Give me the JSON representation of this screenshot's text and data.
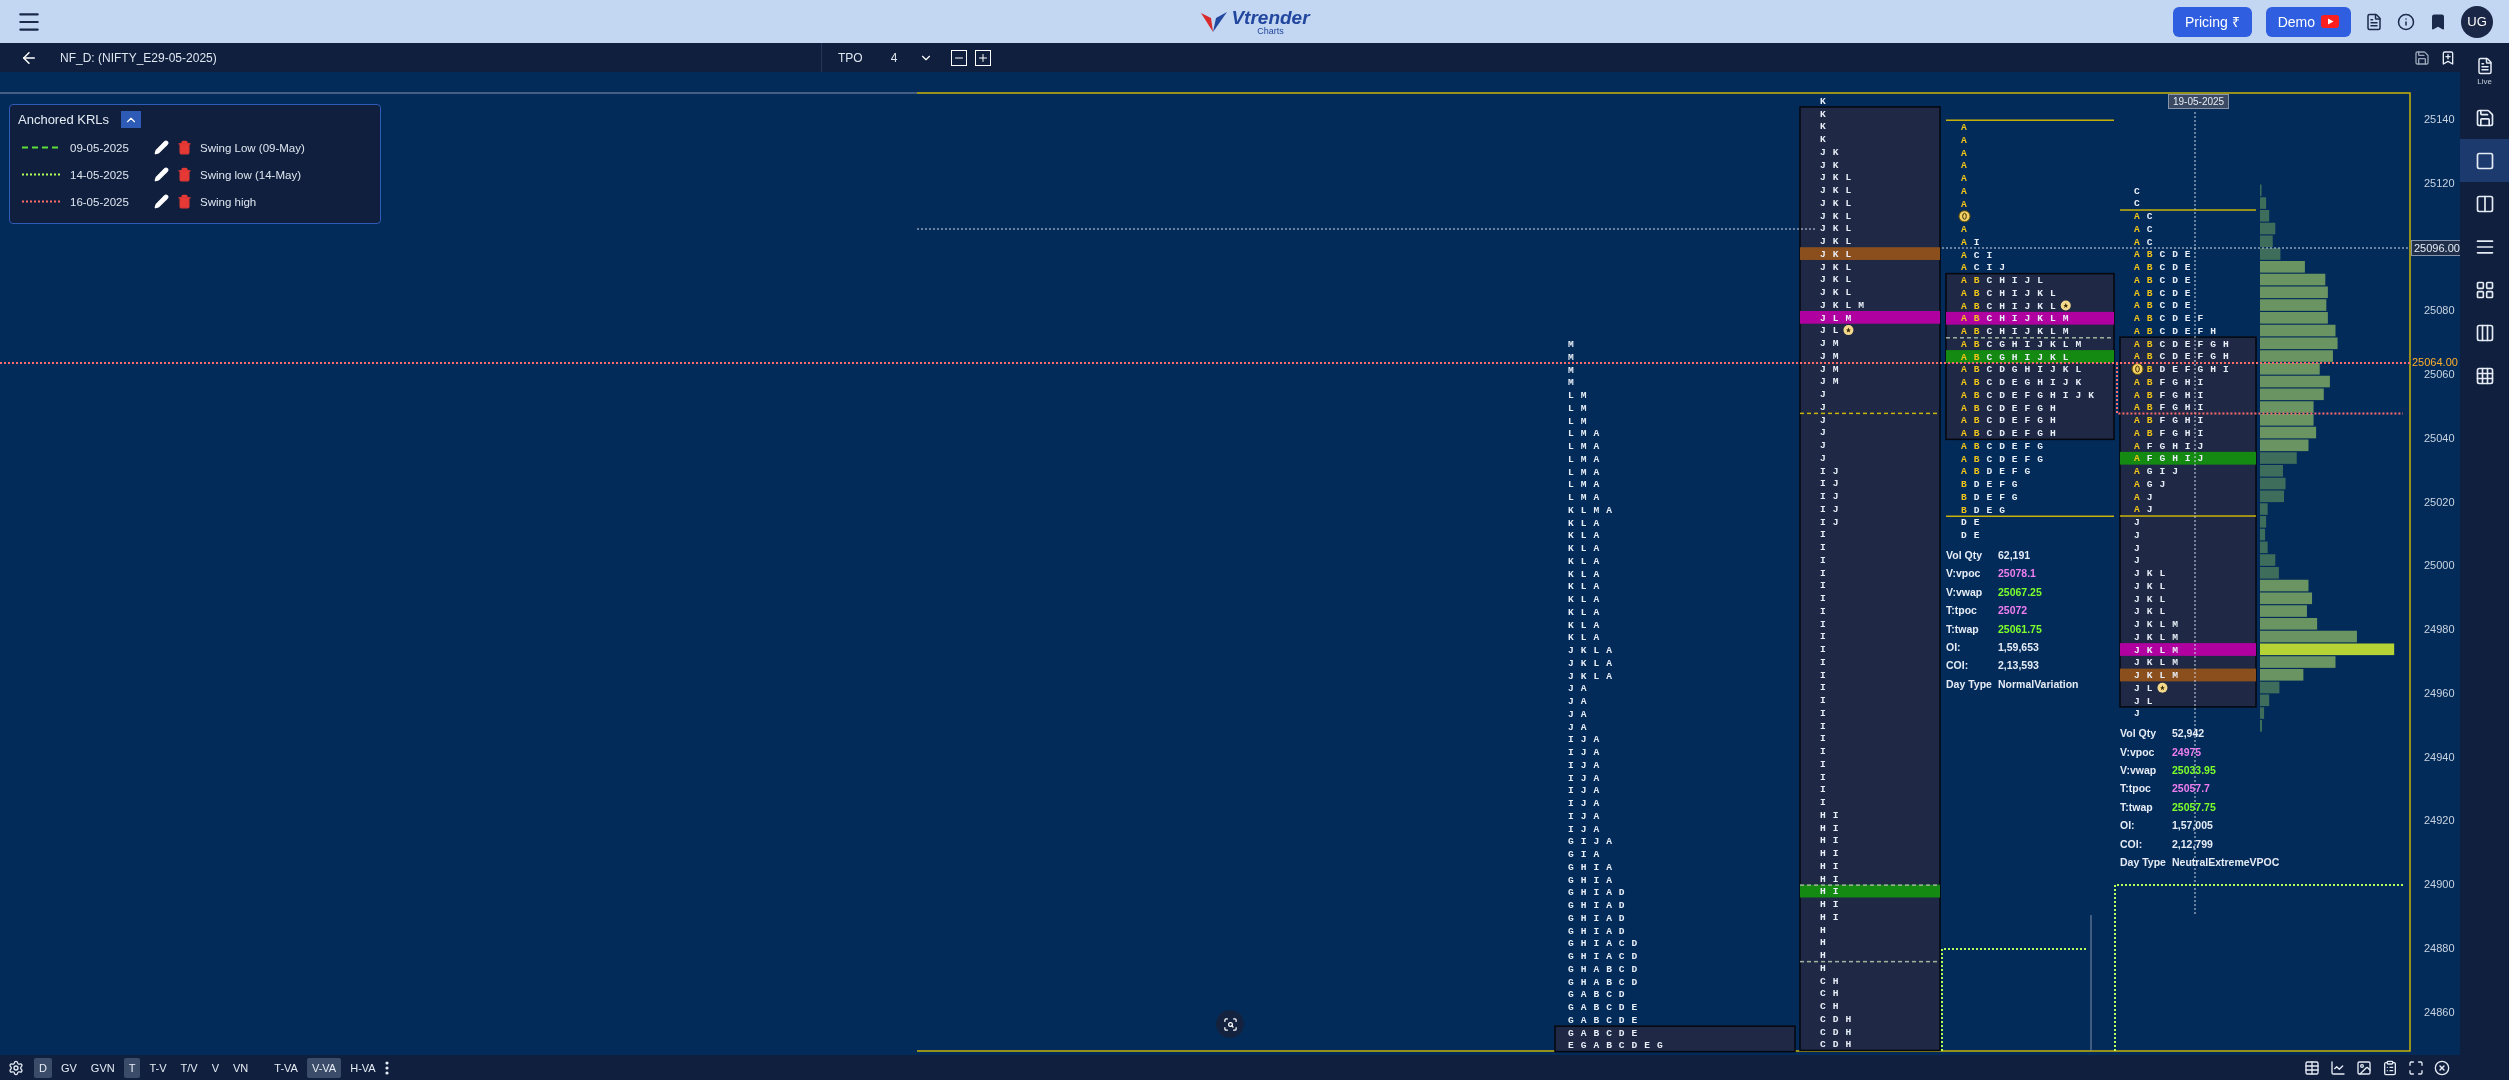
{
  "top_bar": {
    "logo": {
      "name": "Vtrender",
      "tagline": "Charts"
    },
    "buttons": [
      {
        "kind": "pricing",
        "label": "Pricing ₹"
      },
      {
        "kind": "demo",
        "label": "Demo"
      }
    ],
    "avatar": "UG"
  },
  "sub_bar": {
    "symbol": "NF_D: (NIFTY_E29-05-2025)",
    "mode": "TPO",
    "tpo_size": "4"
  },
  "krl_panel": {
    "title": "Anchored KRLs",
    "expanded": true,
    "krls": [
      {
        "date": "09-05-2025",
        "label": "Swing Low (09-May)",
        "dashed": true,
        "color": "#5de03a"
      },
      {
        "date": "14-05-2025",
        "label": "Swing low (14-May)",
        "dashed": false,
        "color": "#b4ff5a"
      },
      {
        "date": "16-05-2025",
        "label": "Swing high",
        "dashed": false,
        "color": "#ff6b6b"
      }
    ]
  },
  "chart": {
    "price_axis": [
      "25140",
      "25120",
      "25080",
      "25060",
      "25040",
      "25020",
      "25000",
      "24980",
      "24960",
      "24940",
      "24920",
      "24900",
      "24880",
      "24860"
    ],
    "crosshair": {
      "date": "19-05-2025",
      "price": "25096.00"
    },
    "last_price": "25064.00",
    "profiles": [
      {
        "above_va": [
          "M",
          "M",
          "M",
          "M",
          "L M",
          "L M",
          "L M",
          "L M A",
          "L M A",
          "L M A",
          "L M A",
          "L M A",
          "L M A",
          "K L M A",
          "K L A",
          "K L A",
          "K L A",
          "K L A",
          "K L A",
          "K L A",
          "K L A",
          "K L A",
          "K L A",
          "K L A",
          "J K L A",
          "J K L A",
          "J K L A",
          "J A",
          "J A",
          "J A",
          "J A",
          "I J A",
          "I J A",
          "I J A",
          "I J A",
          "I J A",
          "I J A",
          "I J A",
          "I J A",
          "G I J A",
          "G I A",
          "G H I A",
          "G H I A",
          "G H I A D",
          "G H I A D",
          "G H I A D",
          "G H I A D",
          "G H I A C D",
          "G H I A C D",
          "G H A B C D",
          "G H A B C D",
          "G A B C D",
          "G A B C D E",
          "G A B C D E"
        ],
        "value_area": [
          "G A B C D E",
          "E G A B C D E G"
        ]
      },
      {
        "above_va": [
          "K"
        ],
        "value_area": [
          "K",
          "K",
          "K",
          "J K",
          "J K",
          "J K L",
          "J K L",
          "J K L",
          "J K L",
          "J K L",
          "J K L",
          {
            "t": "J K L",
            "tpoc": true
          },
          "J K L",
          "J K L",
          "J K L",
          "J K L M",
          {
            "t": "J L M",
            "vpoc": true
          },
          {
            "t": "J L",
            "star_marker": true
          },
          "J M",
          "J M",
          "J M",
          "J M",
          "J",
          {
            "t": "J",
            "mid_line_below": true
          },
          "J",
          "J",
          "J",
          "J",
          "I J",
          "I J",
          "I J",
          "I J",
          "I J",
          "I",
          "I",
          "I",
          "I",
          "I",
          "I",
          "I",
          "I",
          "I",
          "I",
          "I",
          "I",
          "I",
          "I",
          "I",
          "I",
          "I",
          "I",
          "I",
          "I",
          "I",
          "I",
          "H I",
          "H I",
          "H I",
          "H I",
          "H I",
          {
            "t": "H I",
            "va_line_below": true
          },
          {
            "t": "H I",
            "vwap": true
          },
          "H I",
          "H I",
          "H",
          "H",
          {
            "t": "H",
            "va_line_below": true
          },
          "H",
          "C H",
          "C H",
          "C H",
          "C D H",
          "C D H",
          "C D H"
        ]
      },
      {
        "above_va": [
          {
            "ib": "A",
            "ib_line_above": true
          },
          {
            "ib": "A"
          },
          {
            "ib": "A"
          },
          {
            "ib": "A"
          },
          {
            "ib": "A"
          },
          {
            "ib": "A"
          },
          {
            "ib": "A"
          },
          {
            "open_marker": true
          },
          {
            "ib": "A"
          },
          {
            "ib": "A",
            "t": "I"
          },
          {
            "ib": "A",
            "t": "C I"
          },
          {
            "ib": "A",
            "t": "C I J"
          }
        ],
        "value_area": [
          {
            "ib": "A B",
            "t": "C H I J L"
          },
          {
            "ib": "A B",
            "t": "C H I J K L"
          },
          {
            "ib": "A B",
            "t": "C H I J K L",
            "star_marker": true
          },
          {
            "ib": "A B",
            "t": "C H I J K L M",
            "vpoc": true
          },
          {
            "ib": "A B",
            "t": "C H I J K L M",
            "va_line_below": true
          },
          {
            "ib": "A B",
            "t": "C G H I J K L M"
          },
          {
            "ib": "A B",
            "t": "C G H I J K L",
            "vwap": true
          },
          {
            "ib": "A B",
            "t": "C D G H I J K L"
          },
          {
            "ib": "A B",
            "t": "C D E G H I J K"
          },
          {
            "ib": "A B",
            "t": "C D E F G H I J K"
          },
          {
            "ib": "A B",
            "t": "C D E F G H"
          },
          {
            "ib": "A B",
            "t": "C D E F G H"
          },
          {
            "ib": "A B",
            "t": "C D E F G H"
          }
        ],
        "below_va": [
          {
            "ib": "A B",
            "t": "C D E F G"
          },
          {
            "ib": "A B",
            "t": "C D E F G"
          },
          {
            "ib": "A B",
            "t": "D E F G"
          },
          {
            "ib": "B",
            "t": "D E F G"
          },
          {
            "ib": "B",
            "t": "D E F G"
          },
          {
            "ib": "B",
            "t": "D E G",
            "ib_line_below": true
          },
          {
            "t": "D E"
          },
          {
            "t": "D E"
          }
        ],
        "stats": [
          {
            "label": "Vol Qty",
            "value": "62,191"
          },
          {
            "label": "V:vpoc",
            "value": "25078.1",
            "color": "#f07ef0"
          },
          {
            "label": "V:vwap",
            "value": "25067.25",
            "color": "#7dff2a"
          },
          {
            "label": "T:tpoc",
            "value": "25072",
            "color": "#f07ef0"
          },
          {
            "label": "T:twap",
            "value": "25061.75",
            "color": "#7dff2a"
          },
          {
            "label": "OI:",
            "value": "1,59,653"
          },
          {
            "label": "COI:",
            "value": "2,13,593"
          },
          {
            "label": "Day Type",
            "value": "NormalVariation"
          }
        ]
      },
      {
        "above_va": [
          {
            "t": "C"
          },
          {
            "t": "C",
            "ib_line_below": true
          },
          {
            "ib": "A",
            "t": "C"
          },
          {
            "ib": "A",
            "t": "C"
          },
          {
            "ib": "A",
            "t": "C"
          },
          {
            "ib": "A B",
            "t": "C D E"
          },
          {
            "ib": "A B",
            "t": "C D E"
          },
          {
            "ib": "A B",
            "t": "C D E"
          },
          {
            "ib": "A B",
            "t": "C D E"
          },
          {
            "ib": "A B",
            "t": "C D E"
          },
          {
            "ib": "A B",
            "t": "C D E F"
          },
          {
            "ib": "A B",
            "t": "C D E F H"
          }
        ],
        "value_area": [
          {
            "ib": "A B",
            "t": "C D E F G H"
          },
          {
            "ib": "A B",
            "t": "C D E F G H"
          },
          {
            "open_marker": true,
            "ib": "B",
            "t": "D E F G H I"
          },
          {
            "ib": "A B",
            "t": "F G H I"
          },
          {
            "ib": "A B",
            "t": "F G H I"
          },
          {
            "ib": "A B",
            "t": "F G H I"
          },
          {
            "ib": "A B",
            "t": "F G H I"
          },
          {
            "ib": "A B",
            "t": "F G H I"
          },
          {
            "ib": "A",
            "t": "F G H I J"
          },
          {
            "ib": "A",
            "t": "F G H I J",
            "vwap": true
          },
          {
            "ib": "A",
            "t": "G I J"
          },
          {
            "ib": "A",
            "t": "G J"
          },
          {
            "ib": "A",
            "t": "J"
          },
          {
            "ib": "A",
            "t": "J",
            "ib_line_below": true
          },
          {
            "t": "J"
          },
          {
            "t": "J"
          },
          {
            "t": "J"
          },
          {
            "t": "J"
          },
          {
            "t": "J K L"
          },
          {
            "t": "J K L"
          },
          {
            "t": "J K L"
          },
          {
            "t": "J K L"
          },
          {
            "t": "J K L M"
          },
          {
            "t": "J K L M"
          },
          {
            "t": "J K L M",
            "vpoc": true
          },
          {
            "t": "J K L M"
          },
          {
            "t": "J K L M",
            "tpoc": true
          },
          {
            "t": "J L",
            "star_marker": true
          },
          {
            "t": "J L"
          }
        ],
        "below_va": [
          {
            "t": "J"
          }
        ],
        "stats": [
          {
            "label": "Vol Qty",
            "value": "52,942"
          },
          {
            "label": "V:vpoc",
            "value": "24975",
            "color": "#f07ef0"
          },
          {
            "label": "V:vwap",
            "value": "25033.95",
            "color": "#7dff2a"
          },
          {
            "label": "T:tpoc",
            "value": "25057.7",
            "color": "#f07ef0"
          },
          {
            "label": "T:twap",
            "value": "25057.75",
            "color": "#7dff2a"
          },
          {
            "label": "OI:",
            "value": "1,57,005"
          },
          {
            "label": "COI:",
            "value": "2,12,799"
          },
          {
            "label": "Day Type",
            "value": "NeutralExtremeVPOC"
          }
        ]
      }
    ]
  },
  "bottom_bar": {
    "buttons": [
      {
        "label": "D",
        "selected": true
      },
      {
        "label": "GV",
        "selected": false
      },
      {
        "label": "GVN",
        "selected": false
      },
      {
        "label": "T",
        "selected": true
      },
      {
        "label": "T-V",
        "selected": false
      },
      {
        "label": "T/V",
        "selected": false
      },
      {
        "label": "V",
        "selected": false
      },
      {
        "label": "VN",
        "selected": false
      },
      {
        "label": "T-VA",
        "selected": false
      },
      {
        "label": "V-VA",
        "selected": true
      },
      {
        "label": "H-VA",
        "selected": false
      }
    ]
  },
  "right_toolbar": {
    "label": "Live",
    "tools": [
      {
        "selected": false
      },
      {
        "selected": true
      },
      {
        "selected": false
      },
      {
        "selected": false
      },
      {
        "selected": false
      },
      {
        "selected": false
      },
      {
        "selected": false
      }
    ]
  }
}
